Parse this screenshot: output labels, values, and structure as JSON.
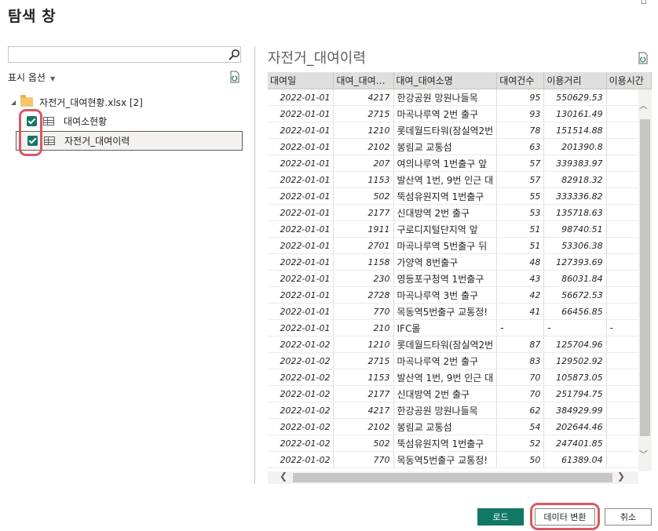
{
  "window": {
    "title": "탐색 창"
  },
  "navigator": {
    "search_placeholder": "",
    "display_options_label": "표시 옵션",
    "file": {
      "name": "자전거_대여현황.xlsx [2]"
    },
    "items": [
      {
        "label": "대여소현황",
        "checked": true
      },
      {
        "label": "자전거_대여이력",
        "checked": true
      }
    ]
  },
  "preview": {
    "title": "자전거_대여이력",
    "columns": [
      "대여일",
      "대여_대여…",
      "대여_대여소명",
      "대여건수",
      "이용거리",
      "이용시간"
    ],
    "rows": [
      [
        "2022-01-01",
        "4217",
        "한강공원 망원나들목",
        "95",
        "550629.53",
        ""
      ],
      [
        "2022-01-01",
        "2715",
        "마곡나루역 2번 출구",
        "93",
        "130161.49",
        ""
      ],
      [
        "2022-01-01",
        "1210",
        "롯데월드타워(잠실역2번",
        "78",
        "151514.88",
        ""
      ],
      [
        "2022-01-01",
        "2102",
        "봉림교 교통섬",
        "63",
        "201390.8",
        ""
      ],
      [
        "2022-01-01",
        "207",
        "여의나루역 1번출구 앞",
        "57",
        "339383.97",
        ""
      ],
      [
        "2022-01-01",
        "1153",
        "발산역 1번, 9번 인근 대",
        "57",
        "82918.32",
        ""
      ],
      [
        "2022-01-01",
        "502",
        "뚝섬유원지역 1번출구",
        "55",
        "333336.82",
        ""
      ],
      [
        "2022-01-01",
        "2177",
        "신대방역 2번 출구",
        "53",
        "135718.63",
        ""
      ],
      [
        "2022-01-01",
        "1911",
        "구로디지털단지역 앞",
        "51",
        "98740.51",
        ""
      ],
      [
        "2022-01-01",
        "2701",
        "마곡나루역 5번출구 뒤",
        "51",
        "53306.38",
        ""
      ],
      [
        "2022-01-01",
        "1158",
        "가양역 8번출구",
        "48",
        "127393.69",
        ""
      ],
      [
        "2022-01-01",
        "230",
        "영등포구청역 1번출구",
        "43",
        "86031.84",
        ""
      ],
      [
        "2022-01-01",
        "2728",
        "마곡나루역 3번 출구",
        "42",
        "56672.53",
        ""
      ],
      [
        "2022-01-01",
        "770",
        "목동역5번출구 교통정!",
        "41",
        "66456.85",
        ""
      ],
      [
        "2022-01-01",
        "210",
        "IFC몰",
        "-",
        "-",
        "-"
      ],
      [
        "2022-01-02",
        "1210",
        "롯데월드타워(잠실역2번",
        "87",
        "125704.96",
        ""
      ],
      [
        "2022-01-02",
        "2715",
        "마곡나루역 2번 출구",
        "83",
        "129502.92",
        ""
      ],
      [
        "2022-01-02",
        "1153",
        "발산역 1번, 9번 인근 대",
        "70",
        "105873.05",
        ""
      ],
      [
        "2022-01-02",
        "2177",
        "신대방역 2번 출구",
        "70",
        "251794.75",
        ""
      ],
      [
        "2022-01-02",
        "4217",
        "한강공원 망원나들목",
        "62",
        "384929.99",
        ""
      ],
      [
        "2022-01-02",
        "2102",
        "봉림교 교통섬",
        "54",
        "202644.46",
        ""
      ],
      [
        "2022-01-02",
        "502",
        "뚝섬유원지역 1번출구",
        "52",
        "247401.85",
        ""
      ],
      [
        "2022-01-02",
        "770",
        "목동역5번출구 교통정!",
        "50",
        "61389.04",
        ""
      ]
    ]
  },
  "buttons": {
    "load": "로드",
    "transform": "데이터 변환",
    "cancel": "취소"
  },
  "colors": {
    "accent": "#117865",
    "highlight": "#d9595f"
  },
  "icons": [
    "search-icon",
    "refresh-icon",
    "folder-icon",
    "table-icon",
    "close-icon"
  ]
}
